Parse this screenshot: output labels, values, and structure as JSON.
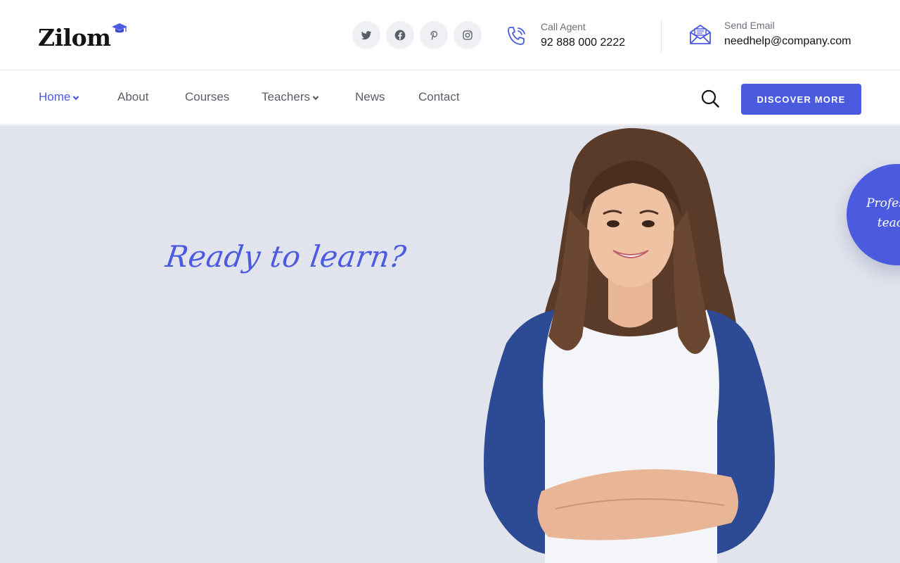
{
  "brand": {
    "name": "Zilom",
    "icon": "graduation-cap-icon",
    "accent": "#4b5be0"
  },
  "header": {
    "socials": [
      {
        "icon": "twitter-icon"
      },
      {
        "icon": "facebook-icon"
      },
      {
        "icon": "pinterest-icon"
      },
      {
        "icon": "instagram-icon"
      }
    ],
    "call": {
      "label": "Call Agent",
      "value": "92 888 000 2222",
      "icon": "phone-icon"
    },
    "email": {
      "label": "Send Email",
      "value": "needhelp@company.com",
      "icon": "envelope-icon"
    }
  },
  "nav": {
    "items": [
      {
        "label": "Home",
        "active": true,
        "dropdown": true
      },
      {
        "label": "About"
      },
      {
        "label": "Courses"
      },
      {
        "label": "Teachers",
        "dropdown": true
      },
      {
        "label": "News"
      },
      {
        "label": "Contact"
      }
    ],
    "search_icon": "search-icon",
    "cta_label": "DISCOVER MORE"
  },
  "hero": {
    "tagline": "Ready to learn?",
    "badge_text": "Professional teachers",
    "background": "#e1e4ec"
  }
}
